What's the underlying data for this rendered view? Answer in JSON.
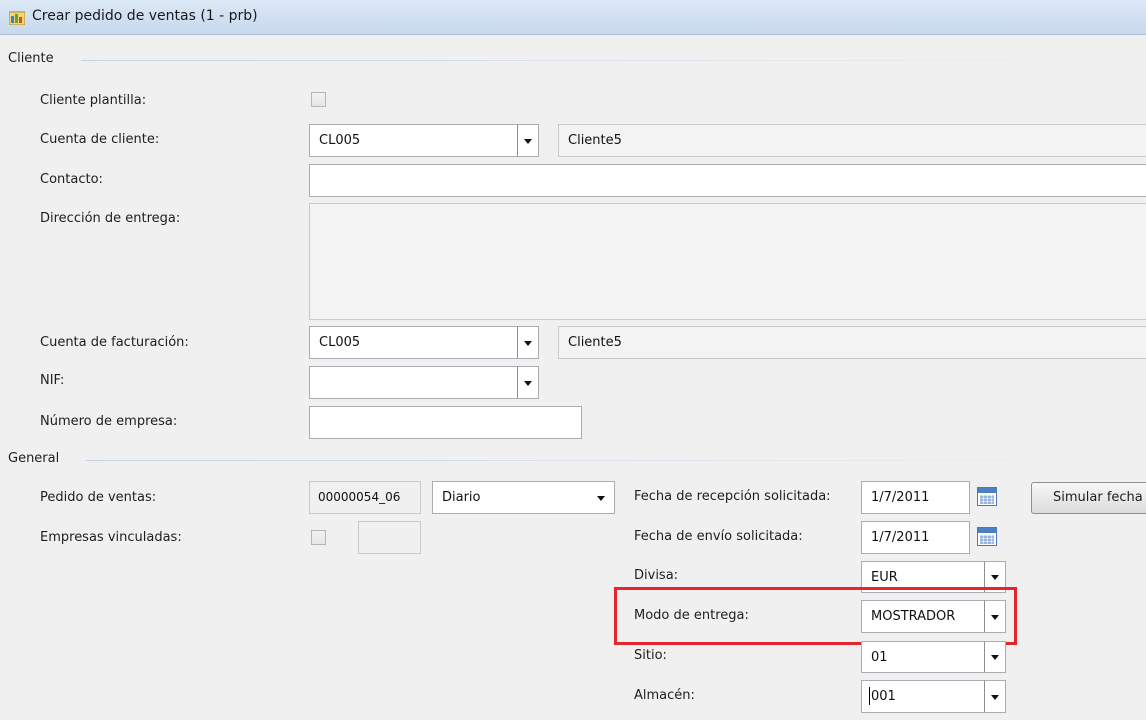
{
  "window": {
    "title": "Crear pedido de ventas (1 - prb)",
    "icon": "app-window-icon"
  },
  "cliente": {
    "group_label": "Cliente",
    "cliente_plantilla": {
      "label": "Cliente plantilla:",
      "checked": false
    },
    "cuenta_cliente": {
      "label": "Cuenta de cliente:",
      "value": "CL005",
      "name": "Cliente5"
    },
    "contacto": {
      "label": "Contacto:",
      "value": ""
    },
    "direccion_entrega": {
      "label": "Dirección de entrega:",
      "value": ""
    },
    "cuenta_facturacion": {
      "label": "Cuenta de facturación:",
      "value": "CL005",
      "name": "Cliente5"
    },
    "nif": {
      "label": "NIF:",
      "value": ""
    },
    "numero_empresa": {
      "label": "Número de empresa:",
      "value": ""
    }
  },
  "general": {
    "group_label": "General",
    "pedido_ventas": {
      "label": "Pedido de ventas:",
      "value": "00000054_06",
      "type": "Diario"
    },
    "empresas_vinculadas": {
      "label": "Empresas vinculadas:",
      "checked": false,
      "value": ""
    },
    "fecha_recepcion": {
      "label": "Fecha de recepción solicitada:",
      "value": "1/7/2011"
    },
    "fecha_envio": {
      "label": "Fecha de envío solicitada:",
      "value": "1/7/2011"
    },
    "divisa": {
      "label": "Divisa:",
      "value": "EUR"
    },
    "modo_entrega": {
      "label": "Modo de entrega:",
      "value": "MOSTRADOR"
    },
    "sitio": {
      "label": "Sitio:",
      "value": "01"
    },
    "almacen": {
      "label": "Almacén:",
      "value": "001"
    },
    "simular_button": "Simular fecha"
  },
  "colors": {
    "highlight": "#e3262d",
    "titlebar": "#c7d9ee",
    "background": "#f0f0f0"
  },
  "icons": [
    "app-window-icon",
    "dropdown-arrow-icon",
    "calendar-icon"
  ]
}
